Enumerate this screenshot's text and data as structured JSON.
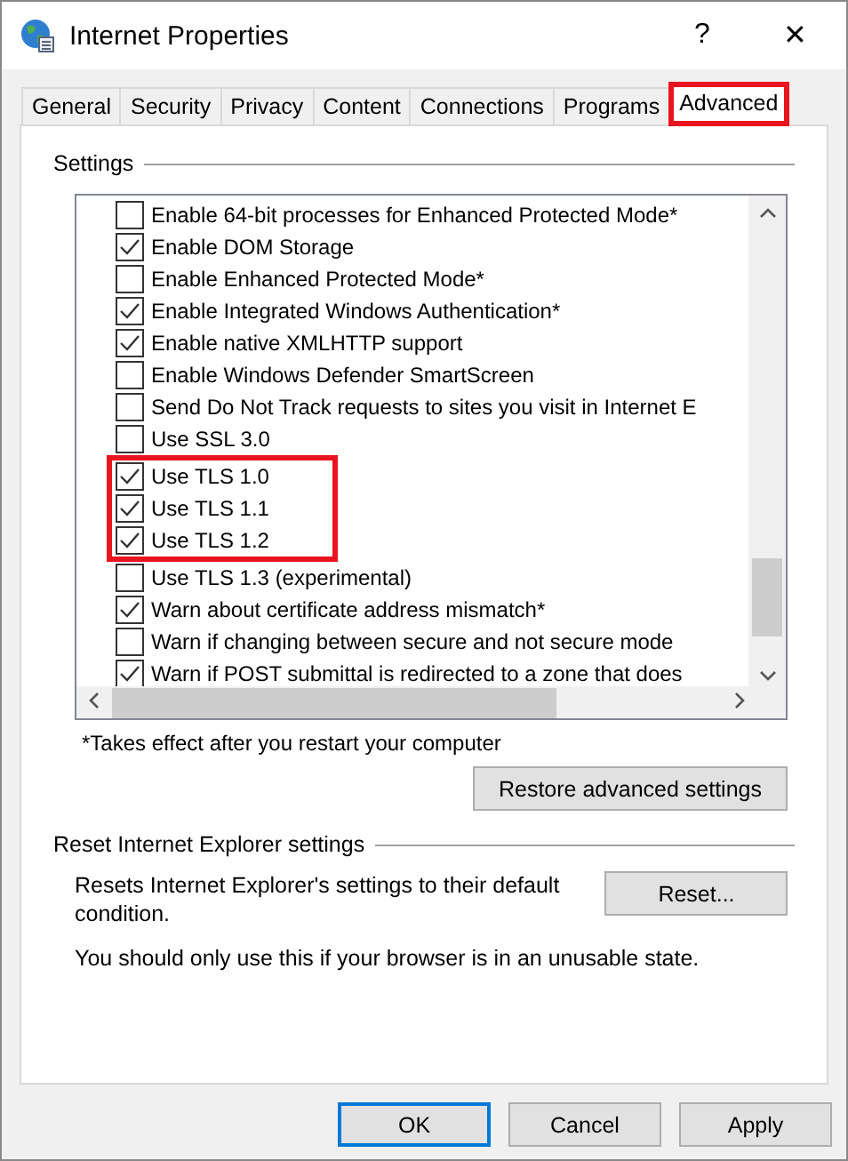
{
  "window": {
    "title": "Internet Properties",
    "help": "?",
    "close": "✕"
  },
  "tabs": [
    {
      "label": "General",
      "selected": false,
      "highlighted": false
    },
    {
      "label": "Security",
      "selected": false,
      "highlighted": false
    },
    {
      "label": "Privacy",
      "selected": false,
      "highlighted": false
    },
    {
      "label": "Content",
      "selected": false,
      "highlighted": false
    },
    {
      "label": "Connections",
      "selected": false,
      "highlighted": false
    },
    {
      "label": "Programs",
      "selected": false,
      "highlighted": false
    },
    {
      "label": "Advanced",
      "selected": true,
      "highlighted": true
    }
  ],
  "settings": {
    "title": "Settings",
    "items": [
      {
        "label": "Enable 64-bit processes for Enhanced Protected Mode*",
        "checked": false,
        "highlighted": false
      },
      {
        "label": "Enable DOM Storage",
        "checked": true,
        "highlighted": false
      },
      {
        "label": "Enable Enhanced Protected Mode*",
        "checked": false,
        "highlighted": false
      },
      {
        "label": "Enable Integrated Windows Authentication*",
        "checked": true,
        "highlighted": false
      },
      {
        "label": "Enable native XMLHTTP support",
        "checked": true,
        "highlighted": false
      },
      {
        "label": "Enable Windows Defender SmartScreen",
        "checked": false,
        "highlighted": false
      },
      {
        "label": "Send Do Not Track requests to sites you visit in Internet E",
        "checked": false,
        "highlighted": false
      },
      {
        "label": "Use SSL 3.0",
        "checked": false,
        "highlighted": false
      },
      {
        "label": "Use TLS 1.0",
        "checked": true,
        "highlighted": true
      },
      {
        "label": "Use TLS 1.1",
        "checked": true,
        "highlighted": true
      },
      {
        "label": "Use TLS 1.2",
        "checked": true,
        "highlighted": true
      },
      {
        "label": "Use TLS 1.3 (experimental)",
        "checked": false,
        "highlighted": false
      },
      {
        "label": "Warn about certificate address mismatch*",
        "checked": true,
        "highlighted": false
      },
      {
        "label": "Warn if changing between secure and not secure mode",
        "checked": false,
        "highlighted": false
      },
      {
        "label": "Warn if POST submittal is redirected to a zone that does",
        "checked": true,
        "highlighted": false
      }
    ],
    "note": "*Takes effect after you restart your computer",
    "restore_button": "Restore advanced settings"
  },
  "reset": {
    "title": "Reset Internet Explorer settings",
    "description": "Resets Internet Explorer's settings to their default condition.",
    "button": "Reset...",
    "warning": "You should only use this if your browser is in an unusable state."
  },
  "buttons": [
    {
      "label": "OK",
      "selected": true
    },
    {
      "label": "Cancel",
      "selected": false
    },
    {
      "label": "Apply",
      "selected": false
    }
  ]
}
